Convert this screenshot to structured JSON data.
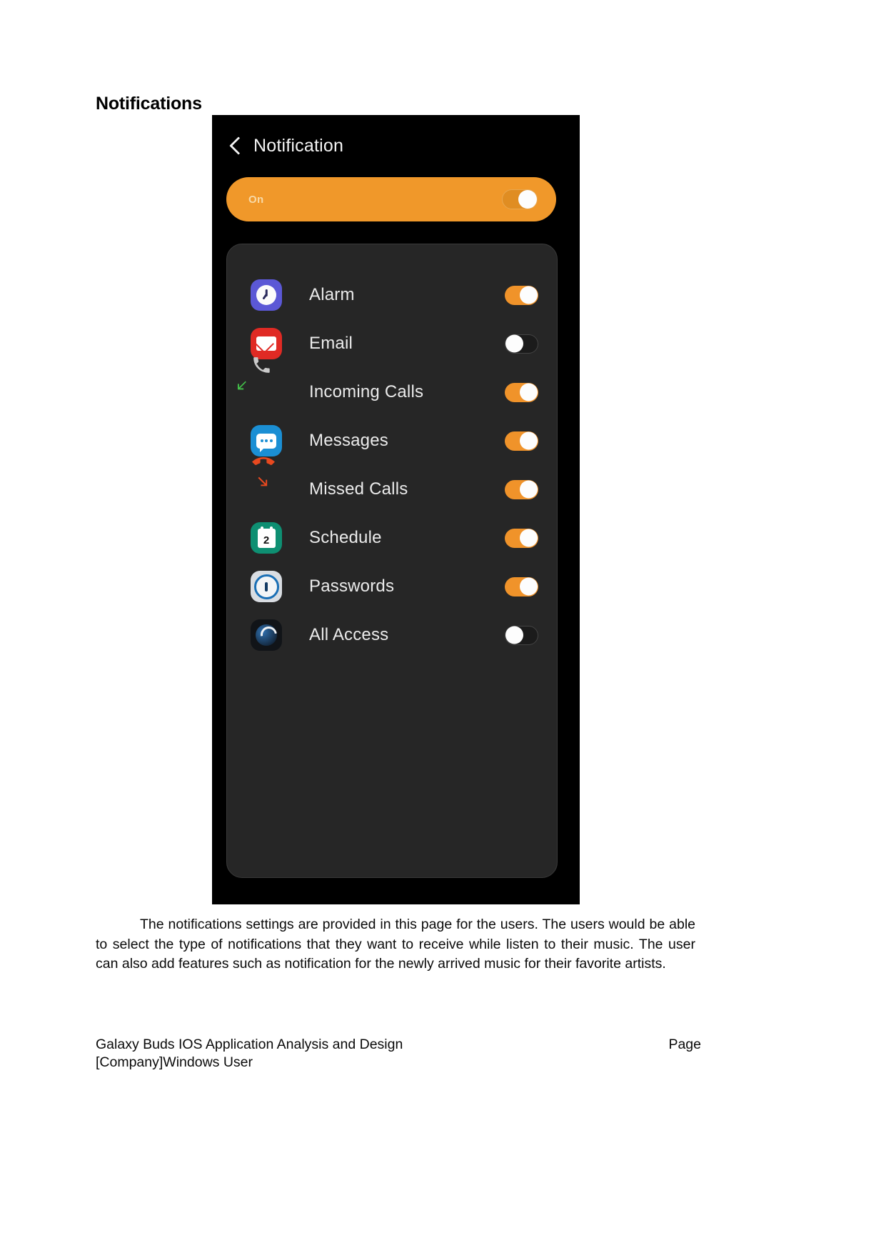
{
  "document": {
    "heading": "Notifications",
    "paragraph": "The notifications settings are provided in this page for the users. The users would be able to select the type of notifications that they want to receive while listen to their music. The user can also add features such as notification for the newly arrived music for their favorite artists.",
    "footer": {
      "left": "Galaxy Buds IOS Application Analysis and Design",
      "right": "Page",
      "sub": "[Company]Windows User"
    }
  },
  "phone": {
    "header": {
      "back_icon": "back-chevron-icon",
      "title": "Notification"
    },
    "master_toggle": {
      "label": "On",
      "state": "on",
      "track_color": "#f0982a",
      "knob_color": "#fdfdfd",
      "bar_color": "#f0982a"
    },
    "colors": {
      "screen_background": "#000000",
      "card_background": "#262626",
      "accent": "#f0932a",
      "text": "#ebebeb"
    },
    "list": [
      {
        "label": "Alarm",
        "icon": "alarm-clock-icon",
        "state": "on"
      },
      {
        "label": "Email",
        "icon": "envelope-icon",
        "state": "off"
      },
      {
        "label": "Incoming Calls",
        "icon": "incoming-call-icon",
        "state": "on"
      },
      {
        "label": "Messages",
        "icon": "message-bubble-icon",
        "state": "on"
      },
      {
        "label": "Missed Calls",
        "icon": "missed-call-icon",
        "state": "on"
      },
      {
        "label": "Schedule",
        "icon": "calendar-icon",
        "state": "on",
        "badge": "2"
      },
      {
        "label": "Passwords",
        "icon": "password-ring-icon",
        "state": "on"
      },
      {
        "label": "All Access",
        "icon": "all-access-icon",
        "state": "off"
      }
    ]
  }
}
